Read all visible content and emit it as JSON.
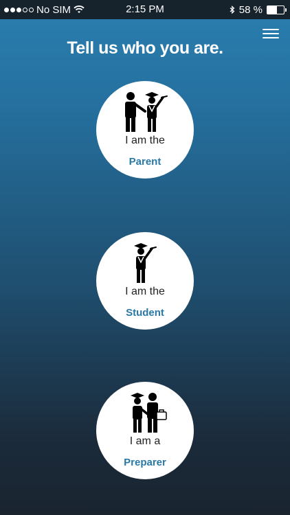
{
  "status_bar": {
    "carrier": "No SIM",
    "time": "2:15 PM",
    "battery_percent": "58 %",
    "battery_level": 0.58,
    "icons": [
      "signal-dots-icon",
      "wifi-icon",
      "bluetooth-icon",
      "battery-icon"
    ]
  },
  "header": {
    "title": "Tell us who you are.",
    "menu_icon": "hamburger-menu-icon"
  },
  "roles": [
    {
      "prefix": "I am the",
      "name": "Parent",
      "icon": "parent-and-student-icon"
    },
    {
      "prefix": "I am the",
      "name": "Student",
      "icon": "student-graduate-icon"
    },
    {
      "prefix": "I am a",
      "name": "Preparer",
      "icon": "preparer-and-student-icon"
    }
  ],
  "colors": {
    "accent": "#2979a6",
    "gradient_top": "#2a7fb0",
    "gradient_bottom": "#19242f"
  }
}
